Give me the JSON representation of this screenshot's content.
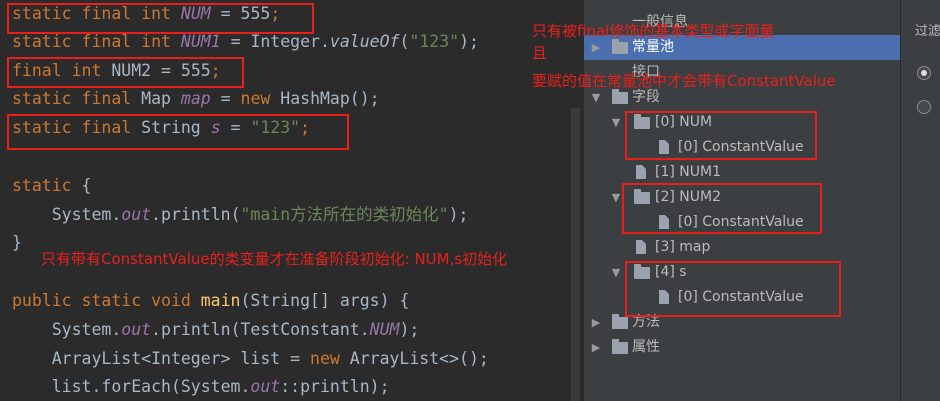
{
  "editor": {
    "lines": [
      {
        "tokens": [
          {
            "t": "static final int ",
            "c": "kw"
          },
          {
            "t": "NUM",
            "c": "const"
          },
          {
            "t": " = ",
            "c": "plain"
          },
          {
            "t": "555",
            "c": "plain"
          },
          {
            "t": ";",
            "c": "kw"
          }
        ]
      },
      {
        "tokens": [
          {
            "t": "static final int ",
            "c": "kw"
          },
          {
            "t": "NUM1",
            "c": "const"
          },
          {
            "t": " = Integer.",
            "c": "plain"
          },
          {
            "t": "valueOf",
            "c": "ital"
          },
          {
            "t": "(",
            "c": "plain"
          },
          {
            "t": "\"123\"",
            "c": "str"
          },
          {
            "t": ");",
            "c": "plain"
          }
        ]
      },
      {
        "tokens": [
          {
            "t": "final int ",
            "c": "kw"
          },
          {
            "t": "NUM2",
            "c": "plain"
          },
          {
            "t": " = ",
            "c": "plain"
          },
          {
            "t": "555",
            "c": "plain"
          },
          {
            "t": ";",
            "c": "kw"
          }
        ]
      },
      {
        "tokens": [
          {
            "t": "static final ",
            "c": "kw"
          },
          {
            "t": "Map ",
            "c": "plain"
          },
          {
            "t": "map",
            "c": "const"
          },
          {
            "t": " = ",
            "c": "plain"
          },
          {
            "t": "new ",
            "c": "kw"
          },
          {
            "t": "HashMap();",
            "c": "plain"
          }
        ]
      },
      {
        "tokens": [
          {
            "t": "static final ",
            "c": "kw"
          },
          {
            "t": "String ",
            "c": "plain"
          },
          {
            "t": "s",
            "c": "const"
          },
          {
            "t": " = ",
            "c": "plain"
          },
          {
            "t": "\"123\"",
            "c": "str"
          },
          {
            "t": ";",
            "c": "kw"
          }
        ]
      },
      {
        "tokens": []
      },
      {
        "tokens": [
          {
            "t": "static ",
            "c": "kw"
          },
          {
            "t": "{",
            "c": "plain"
          }
        ]
      },
      {
        "tokens": [
          {
            "t": "    System.",
            "c": "plain"
          },
          {
            "t": "out",
            "c": "const"
          },
          {
            "t": ".println(",
            "c": "plain"
          },
          {
            "t": "\"main方法所在的类初始化\"",
            "c": "str"
          },
          {
            "t": ");",
            "c": "plain"
          }
        ]
      },
      {
        "tokens": [
          {
            "t": "}",
            "c": "plain"
          }
        ]
      },
      {
        "tokens": []
      },
      {
        "tokens": [
          {
            "t": "public static void ",
            "c": "kw"
          },
          {
            "t": "main",
            "c": "fn"
          },
          {
            "t": "(String[] args) {",
            "c": "plain"
          }
        ]
      },
      {
        "tokens": [
          {
            "t": "    System.",
            "c": "plain"
          },
          {
            "t": "out",
            "c": "const"
          },
          {
            "t": ".println(TestConstant.",
            "c": "plain"
          },
          {
            "t": "NUM",
            "c": "const"
          },
          {
            "t": ");",
            "c": "plain"
          }
        ]
      },
      {
        "tokens": [
          {
            "t": "    ArrayList<Integer> list = ",
            "c": "plain"
          },
          {
            "t": "new ",
            "c": "kw"
          },
          {
            "t": "ArrayList<>();",
            "c": "plain"
          }
        ]
      },
      {
        "tokens": [
          {
            "t": "    list.forEach(System.",
            "c": "plain"
          },
          {
            "t": "out",
            "c": "const"
          },
          {
            "t": "::println);",
            "c": "plain"
          }
        ]
      }
    ]
  },
  "annotations": {
    "top_line1": "只有被final修饰的基本类型或字面量",
    "top_line2": "且",
    "top_line3": "要赋的值在常量池中才会带有ConstantValue",
    "middle": "只有带有ConstantValue的类变量才在准备阶段初始化: NUM,s初始化"
  },
  "tree": {
    "rows": [
      {
        "label": "一般信息",
        "arrow": "",
        "icon": "none",
        "selected": false
      },
      {
        "label": "常量池",
        "arrow": "▶",
        "icon": "folder",
        "selected": true
      },
      {
        "label": "接口",
        "arrow": "",
        "icon": "none",
        "selected": false
      },
      {
        "label": "字段",
        "arrow": "▼",
        "icon": "folder",
        "selected": false
      },
      {
        "label": "[0] NUM",
        "arrow": "▼",
        "icon": "folder",
        "selected": false
      },
      {
        "label": "[0] ConstantValue",
        "arrow": "",
        "icon": "file",
        "selected": false
      },
      {
        "label": "[1] NUM1",
        "arrow": "",
        "icon": "file",
        "selected": false
      },
      {
        "label": "[2] NUM2",
        "arrow": "▼",
        "icon": "folder",
        "selected": false
      },
      {
        "label": "[0] ConstantValue",
        "arrow": "",
        "icon": "file",
        "selected": false
      },
      {
        "label": "[3] map",
        "arrow": "",
        "icon": "file",
        "selected": false
      },
      {
        "label": "[4] s",
        "arrow": "▼",
        "icon": "folder",
        "selected": false
      },
      {
        "label": "[0] ConstantValue",
        "arrow": "",
        "icon": "file",
        "selected": false
      },
      {
        "label": "方法",
        "arrow": "▶",
        "icon": "folder",
        "selected": false
      },
      {
        "label": "属性",
        "arrow": "▶",
        "icon": "folder",
        "selected": false
      }
    ]
  },
  "right_panel": {
    "title": "过滤"
  },
  "colors": {
    "annotation": "#e8201b",
    "editor_bg": "#2b2b2b",
    "panel_bg": "#3c3f41",
    "selection": "#4b6eaf",
    "keyword": "#cc7832",
    "string": "#6a8759",
    "constant": "#9876aa"
  }
}
